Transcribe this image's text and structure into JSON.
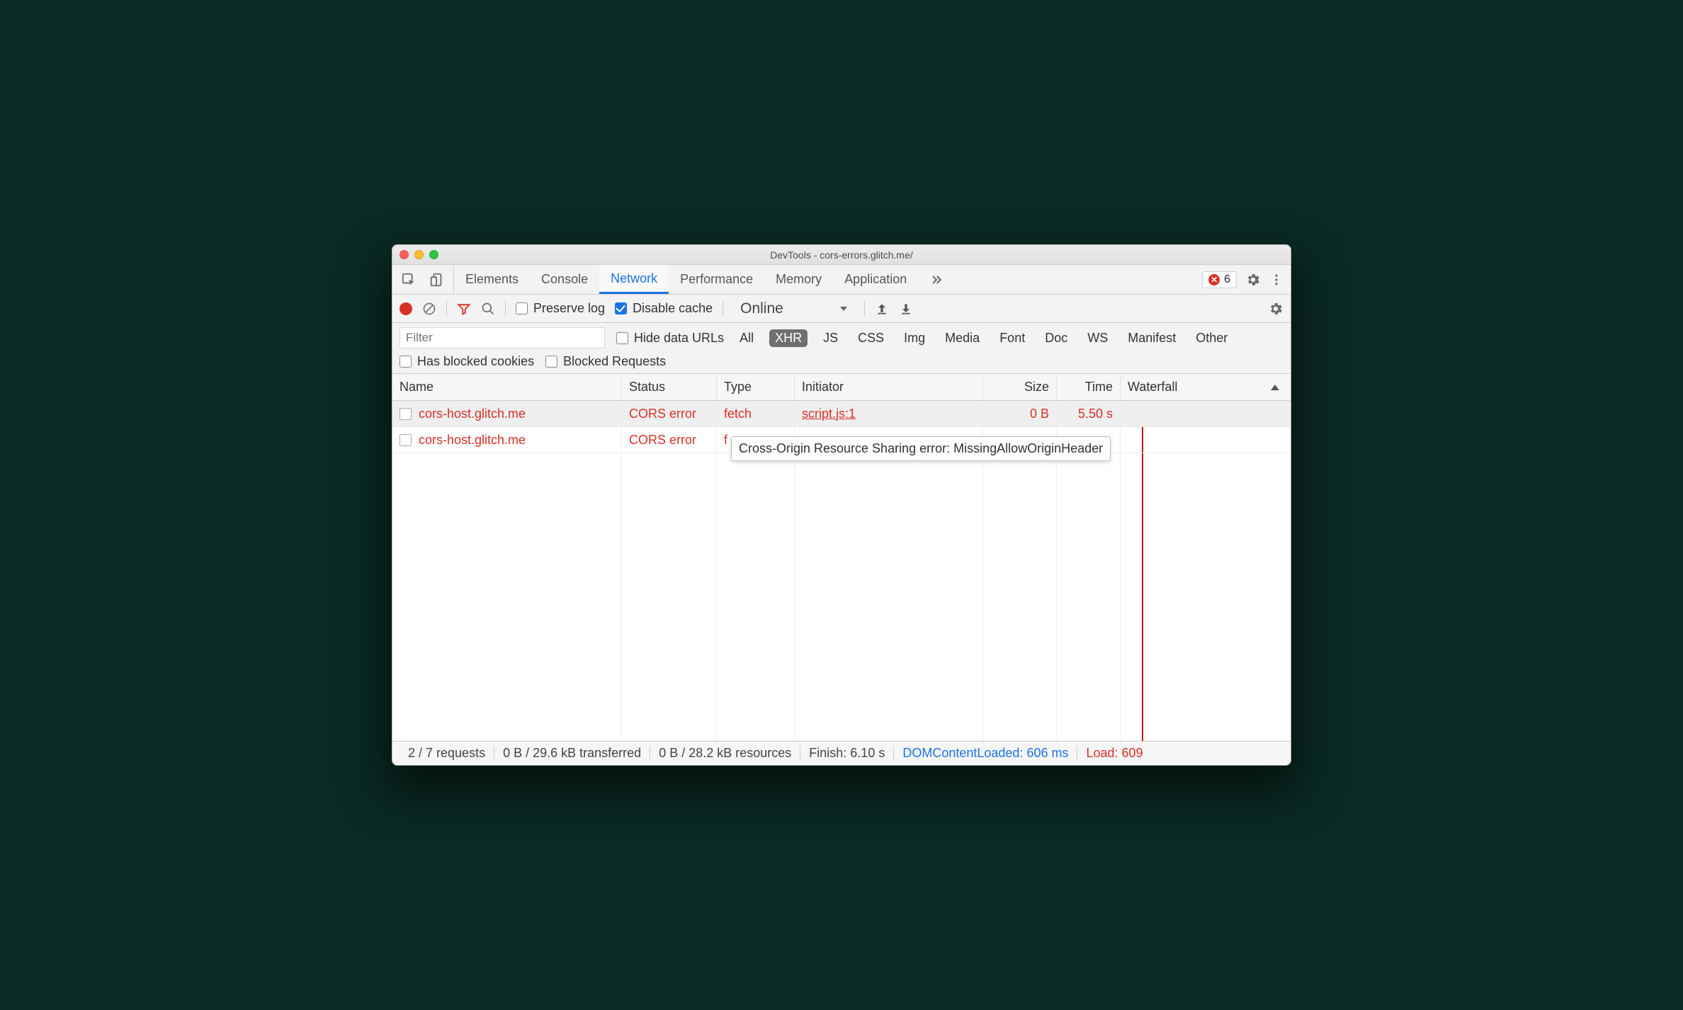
{
  "window_title": "DevTools - cors-errors.glitch.me/",
  "tabs": [
    "Elements",
    "Console",
    "Network",
    "Performance",
    "Memory",
    "Application"
  ],
  "active_tab": "Network",
  "error_count": "6",
  "toolbar": {
    "preserve_log": "Preserve log",
    "disable_cache": "Disable cache",
    "throttling": "Online"
  },
  "filter": {
    "placeholder": "Filter",
    "hide_data_urls": "Hide data URLs",
    "types": [
      "All",
      "XHR",
      "JS",
      "CSS",
      "Img",
      "Media",
      "Font",
      "Doc",
      "WS",
      "Manifest",
      "Other"
    ],
    "selected_type": "XHR",
    "has_blocked_cookies": "Has blocked cookies",
    "blocked_requests": "Blocked Requests"
  },
  "columns": {
    "name": "Name",
    "status": "Status",
    "type": "Type",
    "initiator": "Initiator",
    "size": "Size",
    "time": "Time",
    "waterfall": "Waterfall"
  },
  "rows": [
    {
      "name": "cors-host.glitch.me",
      "status": "CORS error",
      "type": "fetch",
      "initiator": "script.js:1",
      "size": "0 B",
      "time": "5.50 s"
    },
    {
      "name": "cors-host.glitch.me",
      "status": "CORS error",
      "type": "f",
      "initiator": "",
      "size": "",
      "time": ""
    }
  ],
  "tooltip": "Cross-Origin Resource Sharing error: MissingAllowOriginHeader",
  "status": {
    "requests": "2 / 7 requests",
    "transferred": "0 B / 29.6 kB transferred",
    "resources": "0 B / 28.2 kB resources",
    "finish": "Finish: 6.10 s",
    "dcl": "DOMContentLoaded: 606 ms",
    "load": "Load: 609"
  }
}
